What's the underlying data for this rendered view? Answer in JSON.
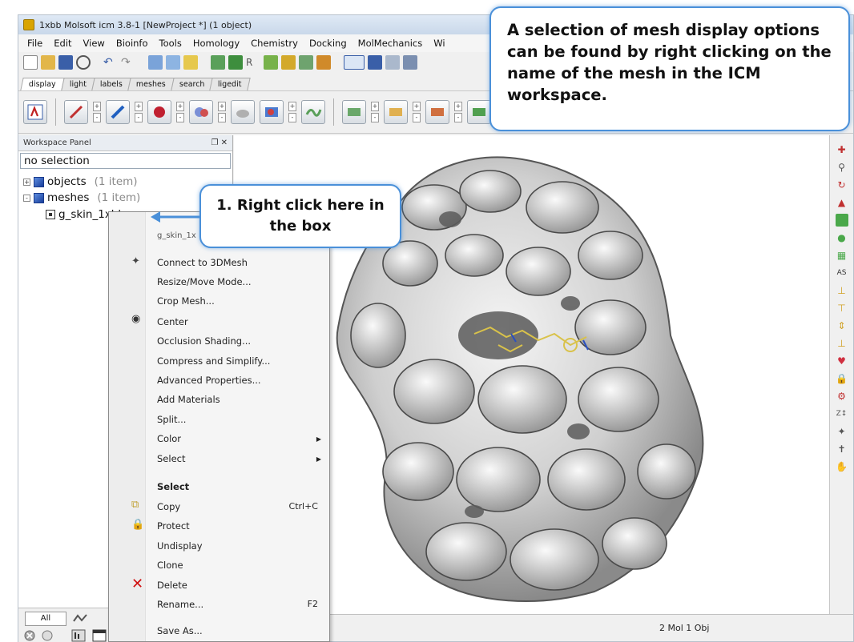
{
  "window": {
    "title": "1xbb Molsoft icm 3.8-1  [NewProject *] (1 object)"
  },
  "menubar": [
    "File",
    "Edit",
    "View",
    "Bioinfo",
    "Tools",
    "Homology",
    "Chemistry",
    "Docking",
    "MolMechanics",
    "Wi"
  ],
  "tabs": [
    "display",
    "light",
    "labels",
    "meshes",
    "search",
    "ligedit"
  ],
  "workspace": {
    "header": "Workspace Panel",
    "header_controls": "❐ ✕",
    "selection": "no selection",
    "tree": [
      {
        "label": "objects",
        "count": "(1 item)"
      },
      {
        "label": "meshes",
        "count": "(1 item)"
      },
      {
        "label": "g_skin_1xbb"
      }
    ],
    "bottom_tab": "All"
  },
  "context_menu": {
    "title_item": "g_skin_1x",
    "items": [
      {
        "label": "Connect to 3DMesh",
        "icon": "connect-icon"
      },
      {
        "label": "Resize/Move Mode..."
      },
      {
        "label": "Crop Mesh..."
      },
      {
        "label": "Center",
        "icon": "center-icon"
      },
      {
        "label": "Occlusion Shading..."
      },
      {
        "label": "Compress and Simplify..."
      },
      {
        "label": "Advanced Properties..."
      },
      {
        "label": "Add Materials"
      },
      {
        "label": "Split..."
      },
      {
        "label": "Color",
        "submenu": true
      },
      {
        "label": "Select",
        "submenu": true
      },
      {
        "label": "Select",
        "bold": true
      },
      {
        "label": "Copy",
        "shortcut": "Ctrl+C",
        "icon": "copy-icon"
      },
      {
        "label": "Protect",
        "icon": "lock-icon"
      },
      {
        "label": "Undisplay"
      },
      {
        "label": "Clone"
      },
      {
        "label": "Delete",
        "icon": "delete-icon"
      },
      {
        "label": "Rename...",
        "shortcut": "F2"
      },
      {
        "label": "Save As..."
      }
    ]
  },
  "status": {
    "text": "2 Mol 1 Obj"
  },
  "callouts": {
    "main": "A selection of mesh display options can be found by right clicking on the name of the mesh in the ICM workspace.",
    "step": "1. Right click here in the box"
  },
  "colors": {
    "callout_border": "#4a90d9",
    "delete_red": "#d01010"
  }
}
